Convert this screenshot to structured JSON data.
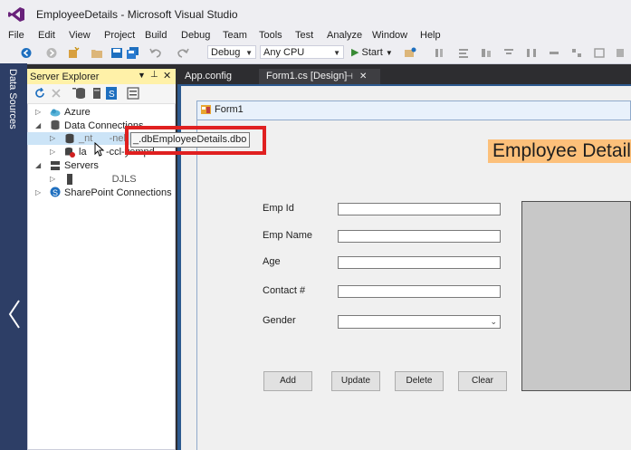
{
  "window": {
    "title": "EmployeeDetails - Microsoft Visual Studio"
  },
  "menu": [
    "File",
    "Edit",
    "View",
    "Project",
    "Build",
    "Debug",
    "Team",
    "Tools",
    "Test",
    "Analyze",
    "Window",
    "Help"
  ],
  "toolbar": {
    "configuration": "Debug",
    "platform": "Any CPU",
    "start_label": "Start"
  },
  "data_sources": {
    "label": "Data Sources"
  },
  "server_explorer": {
    "title": "Server Explorer",
    "tree": {
      "azure": "Azure",
      "data_connections": "Data Connections",
      "connection_1": "_nt      -nel",
      "connection_2": "la       -ccl-yempd",
      "servers": "Servers",
      "server_1": "            DJLS",
      "sharepoint": "SharePoint Connections"
    }
  },
  "tooltip": {
    "text": "_.dbEmployeeDetails.dbo"
  },
  "tabs": [
    {
      "label": "App.config"
    },
    {
      "label": "Form1.cs [Design]"
    }
  ],
  "form": {
    "title": "Form1",
    "header": "Employee Details",
    "labels": {
      "emp_id": "Emp Id",
      "emp_name": "Emp Name",
      "age": "Age",
      "contact": "Contact #",
      "gender": "Gender"
    },
    "inputs": {
      "emp_id": "",
      "emp_name": "",
      "age": "",
      "contact": "",
      "gender": ""
    },
    "buttons": {
      "add": "Add",
      "update": "Update",
      "delete": "Delete",
      "clear": "Clear"
    }
  },
  "colors": {
    "accent_strip": "#2d3e66",
    "designer_border": "#2d5a8f",
    "header_fill": "#fcc07a",
    "highlight": "#e02020",
    "panel_header": "#fff1a8"
  }
}
